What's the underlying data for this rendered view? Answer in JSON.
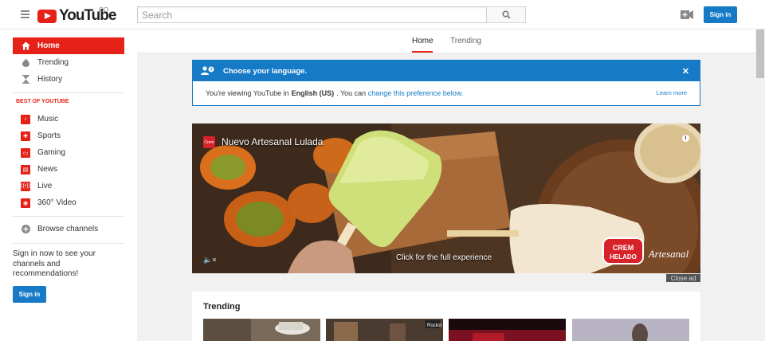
{
  "header": {
    "logo_text": "YouTube",
    "country": "CO",
    "search_placeholder": "Search",
    "signin_label": "Sign in"
  },
  "sidebar": {
    "main_items": [
      {
        "label": "Home",
        "icon": "home-icon"
      },
      {
        "label": "Trending",
        "icon": "flame-icon"
      },
      {
        "label": "History",
        "icon": "hourglass-icon"
      }
    ],
    "section_title": "BEST OF YOUTUBE",
    "best_items": [
      {
        "label": "Music",
        "icon": "music-icon"
      },
      {
        "label": "Sports",
        "icon": "sports-icon"
      },
      {
        "label": "Gaming",
        "icon": "gaming-icon"
      },
      {
        "label": "News",
        "icon": "news-icon"
      },
      {
        "label": "Live",
        "icon": "live-icon"
      },
      {
        "label": "360° Video",
        "icon": "video-360-icon"
      }
    ],
    "browse_label": "Browse channels",
    "signin_prompt": "Sign in now to see your channels and recommendations!",
    "signin_label": "Sign in"
  },
  "tabs": [
    {
      "label": "Home"
    },
    {
      "label": "Trending"
    }
  ],
  "language_prompt": {
    "title": "Choose your language.",
    "text_before": "You're viewing YouTube in",
    "language": "English (US)",
    "text_middle": ". You can",
    "link": "change this preference below.",
    "learn_more": "Learn more"
  },
  "ad": {
    "title": "Nuevo Artesanal Lulada",
    "cta": "Click for the full experience",
    "close_label": "Close ad",
    "brand_small": "Crem",
    "brand_logo": "CREM HELADO",
    "brand_script": "Artesanal"
  },
  "trending": {
    "title": "Trending"
  },
  "colors": {
    "brand_red": "#e62117",
    "link_blue": "#167ac6"
  }
}
